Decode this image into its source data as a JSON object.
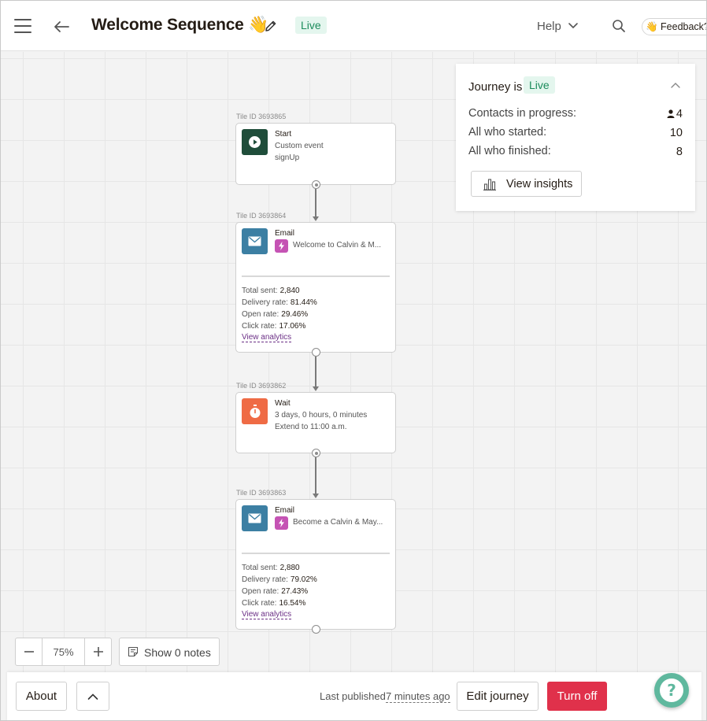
{
  "header": {
    "title": "Welcome Sequence 👋",
    "status": "Live",
    "help_label": "Help",
    "feedback_label": "👋 Feedback?"
  },
  "tiles": [
    {
      "id_label": "Tile ID 3693865",
      "type": "Start",
      "lines": [
        "Custom event",
        "signUp"
      ],
      "icon": "play-icon",
      "color": "#1f4d3a"
    },
    {
      "id_label": "Tile ID 3693864",
      "type": "Email",
      "subject": "Welcome to Calvin & M...",
      "icon": "envelope-icon",
      "color": "#3c7fa3",
      "stats": [
        {
          "label": "Total sent:",
          "value": "2,840"
        },
        {
          "label": "Delivery rate:",
          "value": "81.44%"
        },
        {
          "label": "Open rate:",
          "value": "29.46%"
        },
        {
          "label": "Click rate:",
          "value": "17.06%"
        }
      ],
      "link": "View analytics"
    },
    {
      "id_label": "Tile ID 3693862",
      "type": "Wait",
      "lines": [
        "3 days, 0 hours, 0 minutes",
        "Extend to 11:00 a.m."
      ],
      "icon": "stopwatch-icon",
      "color": "#ef6b45"
    },
    {
      "id_label": "Tile ID 3693863",
      "type": "Email",
      "subject": "Become a Calvin & May...",
      "icon": "envelope-icon",
      "color": "#3c7fa3",
      "stats": [
        {
          "label": "Total sent:",
          "value": "2,880"
        },
        {
          "label": "Delivery rate:",
          "value": "79.02%"
        },
        {
          "label": "Open rate:",
          "value": "27.43%"
        },
        {
          "label": "Click rate:",
          "value": "16.54%"
        }
      ],
      "link": "View analytics"
    }
  ],
  "journey_panel": {
    "title": "Journey is",
    "status": "Live",
    "rows": [
      {
        "label": "Contacts in progress:",
        "value": "4"
      },
      {
        "label": "All who started:",
        "value": "10"
      },
      {
        "label": "All who finished:",
        "value": "8"
      }
    ],
    "insights_label": "View insights"
  },
  "zoom": {
    "value": "75%"
  },
  "notes_label": "Show 0 notes",
  "footer": {
    "about_label": "About",
    "last_published_label": "Last published",
    "last_published_time": "7 minutes ago",
    "edit_label": "Edit journey",
    "turn_off_label": "Turn off"
  },
  "help_fab": "?"
}
